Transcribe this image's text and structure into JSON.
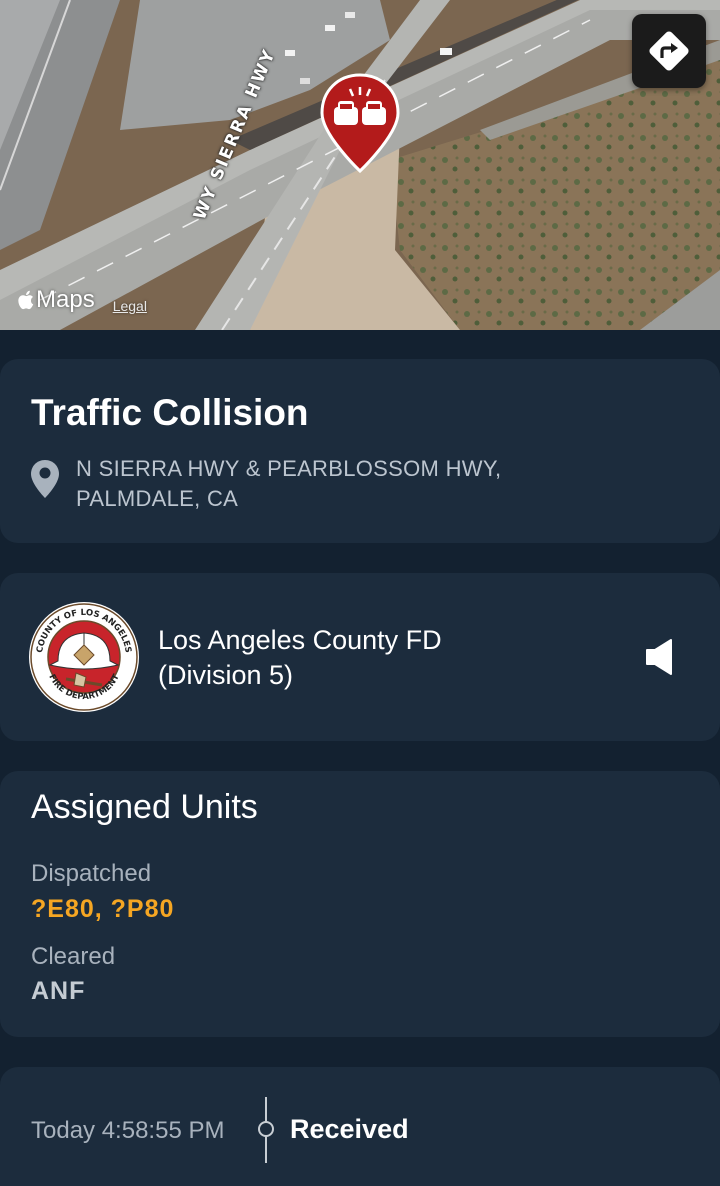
{
  "map": {
    "road_label": "WY SIERRA HWY",
    "maps_brand": "Maps",
    "legal_link": "Legal",
    "pin_icon": "car-collision-icon",
    "directions_icon": "directions-arrow-icon"
  },
  "incident": {
    "title": "Traffic Collision",
    "address_line1": "N SIERRA HWY & PEARBLOSSOM HWY,",
    "address_line2": "PALMDALE, CA",
    "pin_color": "#b31b1b"
  },
  "agency": {
    "logo_text_top": "COUNTY OF LOS ANGELES",
    "logo_text_bottom": "FIRE DEPARTMENT",
    "name_line1": "Los Angeles County FD",
    "name_line2": "(Division 5)",
    "audio_icon": "speaker-icon"
  },
  "units": {
    "title": "Assigned Units",
    "dispatched_label": "Dispatched",
    "dispatched_value": "?E80, ?P80",
    "cleared_label": "Cleared",
    "cleared_value": "ANF",
    "accent_color": "#f5a623"
  },
  "timeline": {
    "time": "Today 4:58:55 PM",
    "status": "Received"
  }
}
